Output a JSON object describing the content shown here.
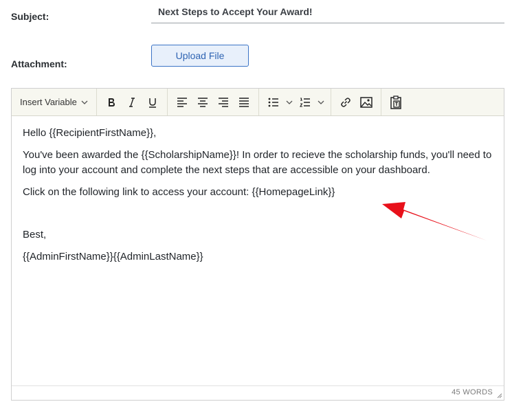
{
  "form": {
    "subject_label": "Subject:",
    "subject_value": "Next Steps to Accept Your Award!",
    "attachment_label": "Attachment:",
    "upload_label": "Upload File"
  },
  "toolbar": {
    "insert_variable": "Insert Variable",
    "buttons": [
      "bold-icon",
      "italic-icon",
      "underline-icon",
      "align-left-icon",
      "align-center-icon",
      "align-right-icon",
      "justify-icon",
      "bullet-list-icon",
      "numbered-list-icon",
      "link-icon",
      "image-icon",
      "paste-text-icon"
    ]
  },
  "body": {
    "greeting": "Hello {{RecipientFirstName}},",
    "paragraph1": "You've been awarded the {{ScholarshipName}}! In order to recieve the scholarship funds, you'll need to log into your account and complete the next steps that are accessible on your dashboard.",
    "paragraph2": "Click on the following link to access your account: {{HomepageLink}}",
    "closing": "Best,",
    "signature": "{{AdminFirstName}}{{AdminLastName}}"
  },
  "status": {
    "word_count": "45 WORDS"
  },
  "colors": {
    "annotation_arrow": "#e8101a",
    "button_border": "#3b73c6"
  }
}
